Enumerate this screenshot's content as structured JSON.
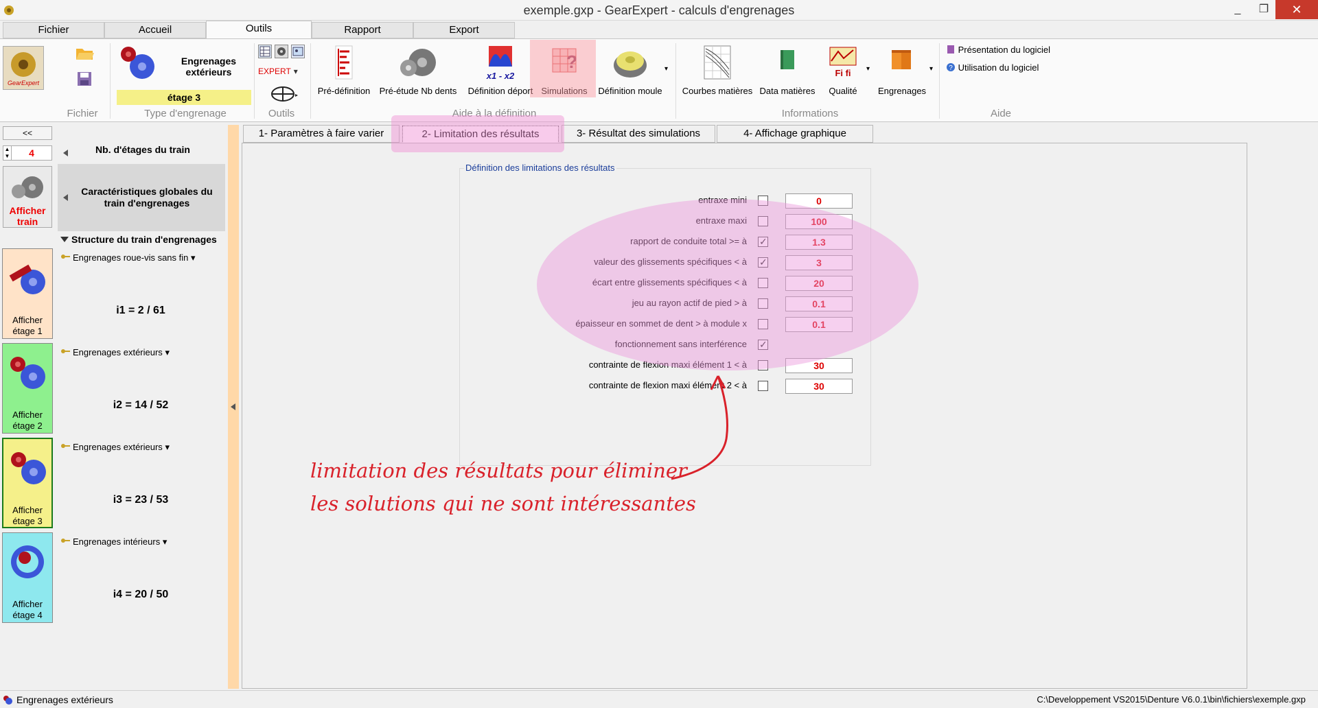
{
  "window": {
    "title": "exemple.gxp - GearExpert - calculs d'engrenages",
    "minimize": "_",
    "maximize": "❐",
    "close": "✕"
  },
  "ribbon_tabs": [
    {
      "label": "Fichier"
    },
    {
      "label": "Accueil"
    },
    {
      "label": "Outils"
    },
    {
      "label": "Rapport"
    },
    {
      "label": "Export"
    }
  ],
  "ribbon": {
    "groups": {
      "fichier": "Fichier",
      "type": "Type d'engrenage",
      "outils": "Outils",
      "aide_def": "Aide à la définition",
      "informations": "Informations",
      "aide": "Aide"
    },
    "type_label": "Engrenages extérieurs",
    "stage_label": "étage 3",
    "expert_label": "EXPERT",
    "buttons": {
      "predefinition": "Pré-définition",
      "preetude": "Pré-étude Nb dents",
      "deport": "Définition déport",
      "simulations": "Simulations",
      "moule": "Définition moule",
      "courbes": "Courbes matières",
      "data": "Data matières",
      "qualite": "Qualité",
      "engrenages": "Engrenages"
    },
    "deport_icon_text": "x1 - x2",
    "qualite_icon_text": "Fi fi",
    "help": {
      "presentation": "Présentation du logiciel",
      "utilisation": "Utilisation du logiciel"
    }
  },
  "left": {
    "collapse": "<<",
    "stage_count": "4",
    "nb_label": "Nb. d'étages du train",
    "show_train": "Afficher train",
    "global_label": "Caractéristiques globales du train d'engrenages",
    "structure_title": "Structure du train d'engrenages",
    "stages": [
      {
        "button": "Afficher étage 1",
        "type": "Engrenages roue-vis sans fin",
        "ratio": "i1 = 2 / 61",
        "color": "#ffe3c8"
      },
      {
        "button": "Afficher étage 2",
        "type": "Engrenages extérieurs",
        "ratio": "i2 = 14 / 52",
        "color": "#8ef08e"
      },
      {
        "button": "Afficher étage 3",
        "type": "Engrenages extérieurs",
        "ratio": "i3 = 23 / 53",
        "color": "#f5f08a"
      },
      {
        "button": "Afficher étage 4",
        "type": "Engrenages intérieurs",
        "ratio": "i4 = 20 / 50",
        "color": "#8ee8ee"
      }
    ]
  },
  "content_tabs": [
    {
      "label": "1- Paramètres à faire varier"
    },
    {
      "label": "2- Limitation des résultats"
    },
    {
      "label": "3- Résultat des simulations"
    },
    {
      "label": "4- Affichage graphique"
    }
  ],
  "limits": {
    "title": "Définition des limitations des résultats",
    "rows": [
      {
        "label": "entraxe mini",
        "checked": false,
        "value": "0"
      },
      {
        "label": "entraxe maxi",
        "checked": false,
        "value": "100"
      },
      {
        "label": "rapport de conduite total >= à",
        "checked": true,
        "value": "1.3"
      },
      {
        "label": "valeur des glissements spécifiques < à",
        "checked": true,
        "value": "3"
      },
      {
        "label": "écart entre glissements spécifiques < à",
        "checked": false,
        "value": "20"
      },
      {
        "label": "jeu au rayon actif de pied > à",
        "checked": false,
        "value": "0.1"
      },
      {
        "label": "épaisseur en sommet de dent > à module x",
        "checked": false,
        "value": "0.1"
      },
      {
        "label": "fonctionnement sans interférence",
        "checked": true,
        "value": null
      },
      {
        "label": "contrainte de flexion maxi élément 1 < à",
        "checked": false,
        "value": "30"
      },
      {
        "label": "contrainte de flexion maxi élément 2 < à",
        "checked": false,
        "value": "30"
      }
    ]
  },
  "annotation": {
    "line1": "limitation des résultats pour éliminer",
    "line2": "les solutions qui ne sont intéressantes"
  },
  "status": {
    "left": "Engrenages extérieurs",
    "right": "C:\\Developpement VS2015\\Denture V6.0.1\\bin\\fichiers\\exemple.gxp"
  },
  "colors": {
    "accent_red": "#d9212a",
    "value_red": "#d00000",
    "highlight_pink": "#ec96dc",
    "splitter": "#ffd8a8"
  }
}
